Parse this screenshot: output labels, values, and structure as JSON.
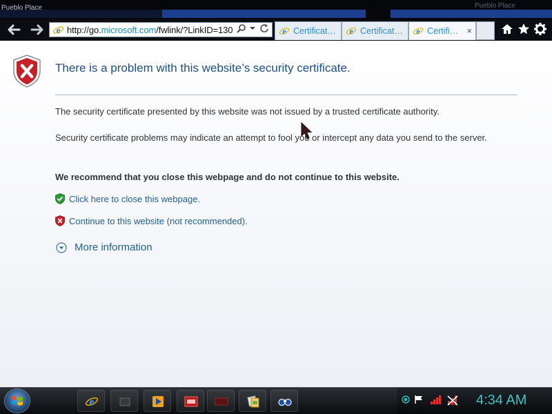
{
  "window": {
    "title": "Pueblo Place"
  },
  "nav": {
    "back_icon": "back-arrow-icon",
    "forward_icon": "forward-arrow-icon",
    "address": {
      "url_prefix": "http://go.",
      "url_host": "microsoft.com",
      "url_suffix": "/fwlink/?LinkID=130",
      "search_icon": "search-icon",
      "dropdown_icon": "chevron-down-icon",
      "refresh_icon": "refresh-icon"
    },
    "tabs": [
      {
        "label": "Certificat…"
      },
      {
        "label": "Certificat…"
      },
      {
        "label": "Certifi…"
      }
    ],
    "tab_close_glyph": "×",
    "commands": {
      "home_icon": "home-icon",
      "favorites_icon": "star-icon",
      "tools_icon": "gear-icon"
    }
  },
  "page": {
    "heading": "There is a problem with this website’s security certificate.",
    "para1": "The security certificate presented by this website was not issued by a trusted certificate authority.",
    "para2": "Security certificate problems may indicate an attempt to fool you or intercept any data you send to the server.",
    "recommend": "We recommend that you close this webpage and do not continue to this website.",
    "close_link": "Click here to close this webpage.",
    "continue_link": "Continue to this website (not recommended).",
    "more_info": "More information"
  },
  "taskbar": {
    "start_icon": "windows-start-icon",
    "pinned": [
      {
        "icon": "internet-explorer-icon"
      },
      {
        "icon": "app-dark-icon"
      },
      {
        "icon": "media-player-icon"
      },
      {
        "icon": "red-app-icon"
      },
      {
        "icon": "dark-red-app-icon"
      },
      {
        "icon": "documents-icon"
      },
      {
        "icon": "binoculars-icon"
      }
    ],
    "tray_icons": [
      "network-dot-icon",
      "flag-icon",
      "signal-bars-icon",
      "network-error-icon"
    ],
    "clock": "4:34 AM"
  },
  "colors": {
    "heading": "#1f4f86",
    "link": "#1f5f96",
    "clock": "#3cc3c8",
    "tab_label": "#2a8dd2",
    "danger": "#c8202a",
    "safe": "#2e9a37"
  }
}
